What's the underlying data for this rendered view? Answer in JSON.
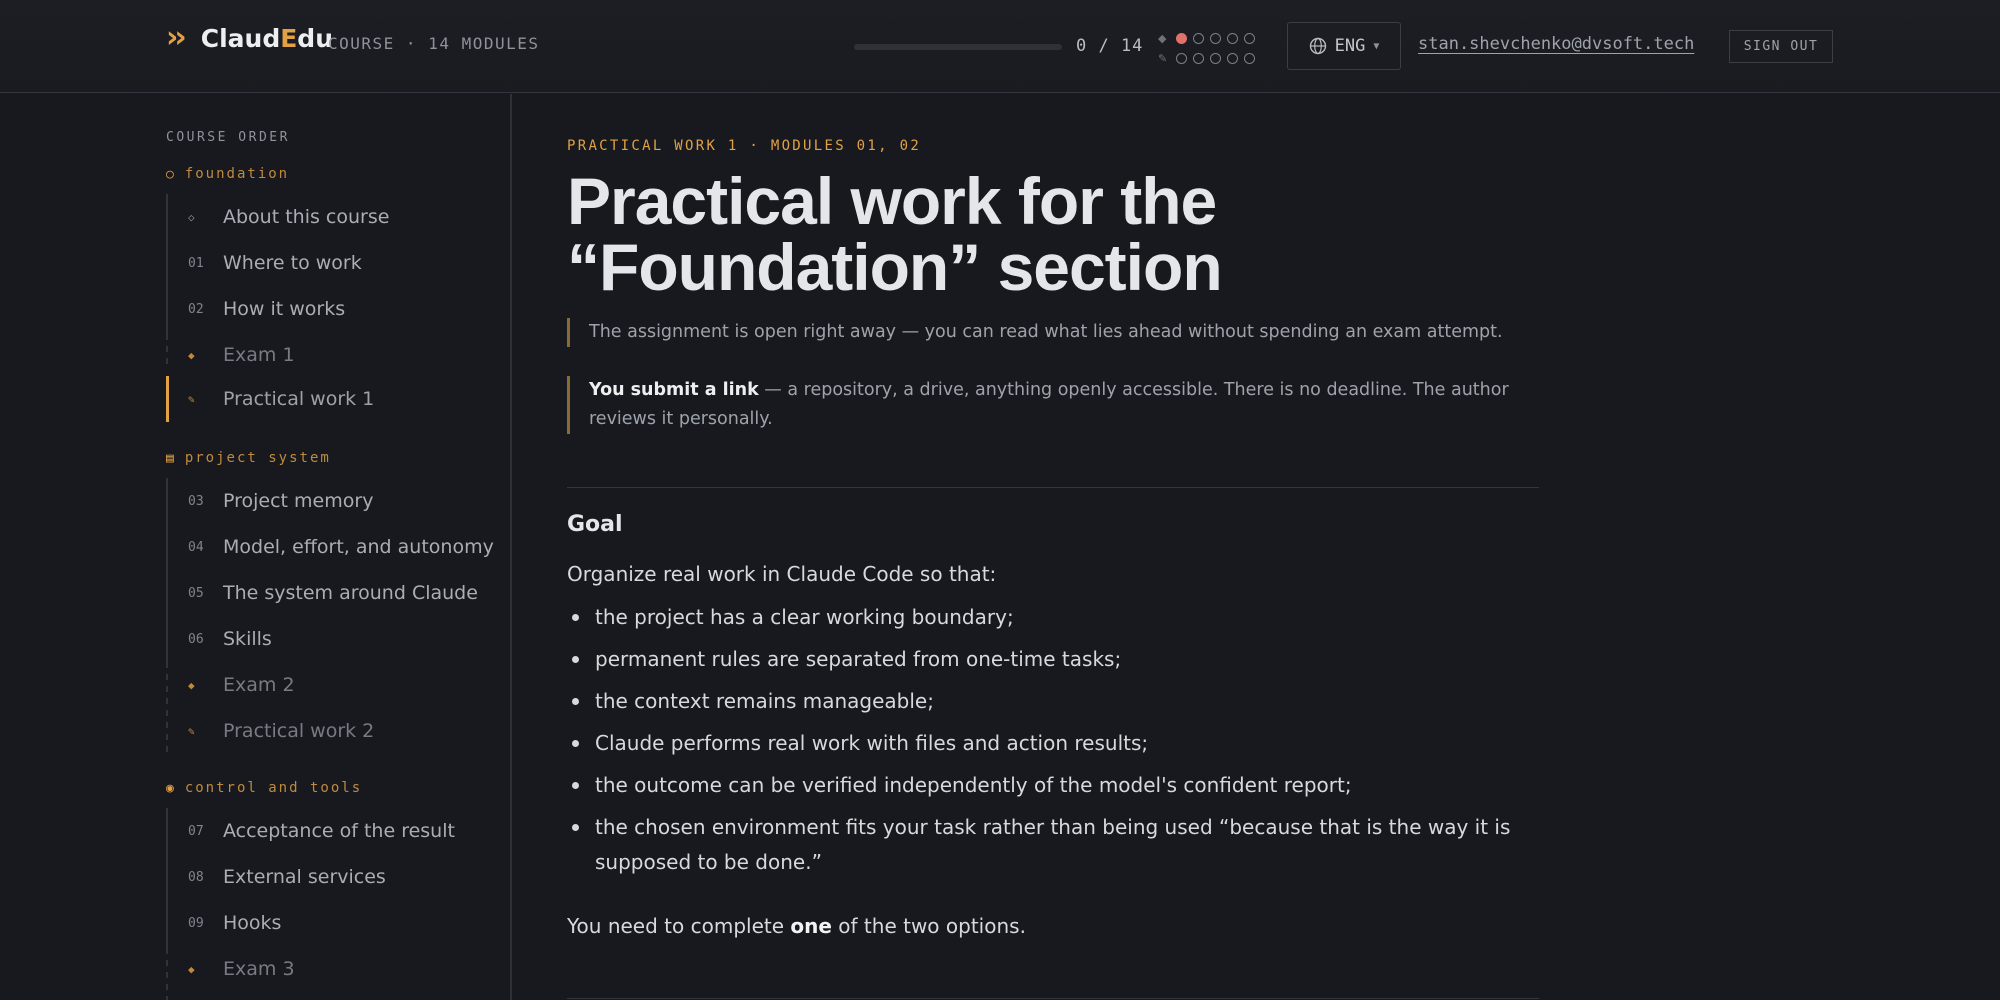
{
  "header": {
    "logo_part1": "Claud",
    "logo_accent": "E",
    "logo_part2": "du",
    "subtitle": "COURSE · 14 MODULES",
    "progress_label": "0 / 14",
    "progress_fraction": 0,
    "lang_label": "ENG",
    "email": "stan.shevchenko@dvsoft.tech",
    "sign_out": "SIGN OUT",
    "accent_color": "#e2a144"
  },
  "sidebar": {
    "heading": "COURSE ORDER",
    "sections": [
      {
        "title": "foundation",
        "icon": "circle-outline-icon",
        "items": [
          {
            "num": "◇",
            "label": "About this course"
          },
          {
            "num": "01",
            "label": "Where to work"
          },
          {
            "num": "02",
            "label": "How it works"
          },
          {
            "num": "◆",
            "label": "Exam 1"
          },
          {
            "num": "✎",
            "label": "Practical work 1"
          }
        ]
      },
      {
        "title": "project system",
        "icon": "square-grid-icon",
        "items": [
          {
            "num": "03",
            "label": "Project memory"
          },
          {
            "num": "04",
            "label": "Model, effort, and autonomy"
          },
          {
            "num": "05",
            "label": "The system around Claude"
          },
          {
            "num": "06",
            "label": "Skills"
          },
          {
            "num": "◆",
            "label": "Exam 2"
          },
          {
            "num": "✎",
            "label": "Practical work 2"
          }
        ]
      },
      {
        "title": "control and tools",
        "icon": "target-circle-icon",
        "items": [
          {
            "num": "07",
            "label": "Acceptance of the result"
          },
          {
            "num": "08",
            "label": "External services"
          },
          {
            "num": "09",
            "label": "Hooks"
          },
          {
            "num": "◆",
            "label": "Exam 3"
          }
        ]
      }
    ]
  },
  "main": {
    "eyebrow": "PRACTICAL WORK 1 · MODULES 01, 02",
    "title": "Practical work for the “Foundation” section",
    "callout1": "The assignment is open right away — you can read what lies ahead without spending an exam attempt.",
    "callout2_bold": "You submit a link",
    "callout2_rest": " — a repository, a drive, anything openly accessible. There is no deadline. The author reviews it personally.",
    "goal_heading": "Goal",
    "goal_intro": "Organize real work in Claude Code so that:",
    "goal_items": [
      "the project has a clear working boundary;",
      "permanent rules are separated from one-time tasks;",
      "the context remains manageable;",
      "Claude performs real work with files and action results;",
      "the outcome can be verified independently of the model's confident report;",
      "the chosen environment fits your task rather than being used “because that is the way it is supposed to be done.”"
    ],
    "complete_pre": "You need to complete ",
    "complete_bold": "one",
    "complete_post": " of the two options."
  }
}
